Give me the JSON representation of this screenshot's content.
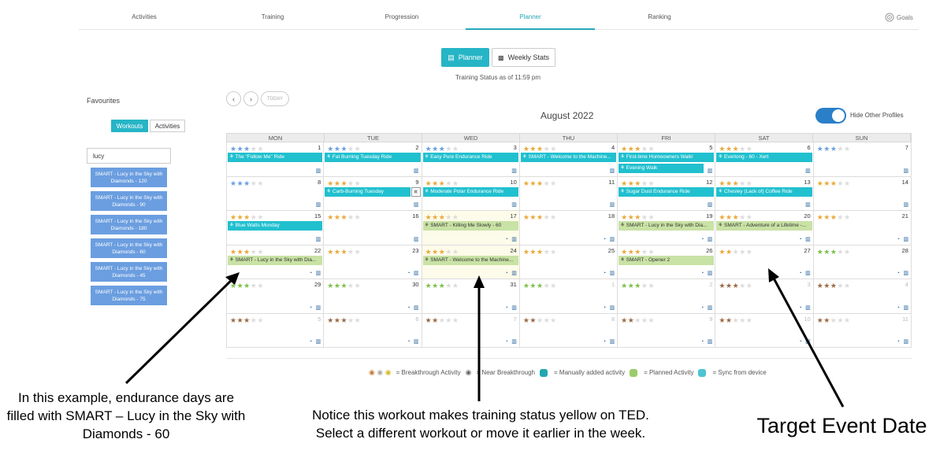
{
  "nav": {
    "items": [
      "Activities",
      "Training",
      "Progression",
      "Planner",
      "Ranking"
    ],
    "goals_label": "Goals"
  },
  "view_buttons": {
    "planner": "Planner",
    "weekly": "Weekly Stats"
  },
  "training_status": "Training Status as of 11:59 pm",
  "favourites": {
    "title": "Favourites",
    "tab_workouts": "Workouts",
    "tab_activities": "Activities",
    "search_value": "lucy",
    "items": [
      "SMART - Lucy in the Sky with Diamonds - 120",
      "SMART - Lucy in the Sky with Diamonds - 90",
      "SMART - Lucy in the Sky with Diamonds - 180",
      "SMART - Lucy in the Sky with Diamonds - 60",
      "SMART - Lucy in the Sky with Diamonds - 45",
      "SMART - Lucy in the Sky with Diamonds - 75"
    ]
  },
  "calendar": {
    "today_label": "TODAY",
    "month": "August 2022",
    "hide_profiles_label": "Hide Other Profiles",
    "days": [
      "MON",
      "TUE",
      "WED",
      "THU",
      "FRI",
      "SAT",
      "SUN"
    ],
    "weeks": [
      [
        {
          "d": "1",
          "stars": 3,
          "c": "blue",
          "e1": "The \"Follow Me\" Ride",
          "t1": "teal"
        },
        {
          "d": "2",
          "stars": 3,
          "c": "blue",
          "e1": "Fat Burning Tuesday Ride",
          "t1": "teal"
        },
        {
          "d": "3",
          "stars": 3,
          "c": "blue",
          "e1": "Easy Pure Endurance Ride",
          "t1": "teal"
        },
        {
          "d": "4",
          "stars": 3,
          "c": "gold",
          "e1": "SMART - Welcome to the Machine...",
          "t1": "teal"
        },
        {
          "d": "5",
          "stars": 3,
          "c": "gold",
          "e1": "First-time Homeowners Walk!",
          "t1": "teal",
          "e2": "Evening Walk",
          "t2": "teal"
        },
        {
          "d": "6",
          "stars": 3,
          "c": "gold",
          "e1": "Everlong - 60 - Xert",
          "t1": "teal"
        },
        {
          "d": "7",
          "stars": 3,
          "c": "blue"
        }
      ],
      [
        {
          "d": "8",
          "stars": 3,
          "c": "blue"
        },
        {
          "d": "9",
          "stars": 3,
          "c": "gold",
          "e1": "Carb-Burning Tuesday",
          "t1": "teal",
          "thumb": true
        },
        {
          "d": "10",
          "stars": 3,
          "c": "gold",
          "e1": "Moderate Polar Endurance Ride",
          "t1": "teal"
        },
        {
          "d": "11",
          "stars": 3,
          "c": "gold"
        },
        {
          "d": "12",
          "stars": 3,
          "c": "gold",
          "e1": "Sugar Dust Endurance Ride",
          "t1": "teal"
        },
        {
          "d": "13",
          "stars": 3,
          "c": "gold",
          "e1": "Chesley (Lack of) Coffee Ride",
          "t1": "teal"
        },
        {
          "d": "14",
          "stars": 3,
          "c": "gold"
        }
      ],
      [
        {
          "d": "15",
          "stars": 3,
          "c": "gold",
          "e1": "Blue Watts Monday",
          "t1": "teal"
        },
        {
          "d": "16",
          "stars": 3,
          "c": "gold"
        },
        {
          "d": "17",
          "stars": 3,
          "c": "gold",
          "e1": "SMART - Killing Me Slowly - 60",
          "t1": "green",
          "hl": true,
          "gauge": true
        },
        {
          "d": "18",
          "stars": 3,
          "c": "gold",
          "gauge": true
        },
        {
          "d": "19",
          "stars": 3,
          "c": "gold",
          "e1": "SMART - Lucy in the Sky with Dia...",
          "t1": "green",
          "gauge": true
        },
        {
          "d": "20",
          "stars": 3,
          "c": "gold",
          "e1": "SMART - Adventure of a Lifetime -...",
          "t1": "green",
          "gauge": true
        },
        {
          "d": "21",
          "stars": 3,
          "c": "gold",
          "gauge": true
        }
      ],
      [
        {
          "d": "22",
          "stars": 3,
          "c": "gold",
          "e1": "SMART - Lucy in the Sky with Dia...",
          "t1": "green",
          "gauge": true
        },
        {
          "d": "23",
          "stars": 3,
          "c": "gold",
          "gauge": true
        },
        {
          "d": "24",
          "stars": 3,
          "c": "gold",
          "e1": "SMART - Welcome to the Machine...",
          "t1": "green",
          "hl": true,
          "gauge": true
        },
        {
          "d": "25",
          "stars": 3,
          "c": "gold",
          "gauge": true
        },
        {
          "d": "26",
          "stars": 3,
          "c": "gold",
          "e1": "SMART - Opener 2",
          "t1": "green",
          "gauge": true
        },
        {
          "d": "27",
          "stars": 2,
          "c": "gold",
          "gauge": true
        },
        {
          "d": "28",
          "stars": 3,
          "c": "green",
          "gauge": true
        }
      ],
      [
        {
          "d": "29",
          "stars": 3,
          "c": "green",
          "gauge": true
        },
        {
          "d": "30",
          "stars": 3,
          "c": "green",
          "gauge": true
        },
        {
          "d": "31",
          "stars": 3,
          "c": "green",
          "gauge": true
        },
        {
          "d": "1",
          "stars": 3,
          "c": "green",
          "dim": true,
          "gauge": true
        },
        {
          "d": "2",
          "stars": 3,
          "c": "green",
          "dim": true,
          "gauge": true
        },
        {
          "d": "3",
          "stars": 3,
          "c": "brown",
          "dim": true,
          "gauge": true
        },
        {
          "d": "4",
          "stars": 3,
          "c": "brown",
          "dim": true,
          "gauge": true
        }
      ],
      [
        {
          "d": "5",
          "stars": 3,
          "c": "brown",
          "dim": true,
          "gauge": true
        },
        {
          "d": "6",
          "stars": 3,
          "c": "brown",
          "dim": true,
          "gauge": true
        },
        {
          "d": "7",
          "stars": 2,
          "c": "brown",
          "dim": true,
          "gauge": true
        },
        {
          "d": "8",
          "stars": 2,
          "c": "brown",
          "dim": true,
          "gauge": true
        },
        {
          "d": "9",
          "stars": 2,
          "c": "brown",
          "dim": true,
          "gauge": true
        },
        {
          "d": "10",
          "stars": 2,
          "c": "brown",
          "dim": true,
          "gauge": true
        },
        {
          "d": "11",
          "stars": 2,
          "c": "brown",
          "dim": true,
          "gauge": true
        }
      ]
    ]
  },
  "legend": {
    "breakthrough": "= Breakthrough Activity",
    "near": "= Near Breakthrough",
    "manual": "= Manually added activity",
    "planned": "= Planned Activity",
    "sync": "= Sync from device"
  },
  "star_colors": {
    "blue": "#6a9fe0",
    "gold": "#e8a93a",
    "green": "#7cc04a",
    "brown": "#9b6a44",
    "empty": "#dcdcdc"
  },
  "annotations": {
    "left": "In this example, endurance days are filled with SMART – Lucy in the Sky with Diamonds - 60",
    "middle_1": "Notice this workout makes training status yellow on TED.",
    "middle_2": "Select a different workout or move it earlier in the week.",
    "right": "Target Event Date"
  }
}
